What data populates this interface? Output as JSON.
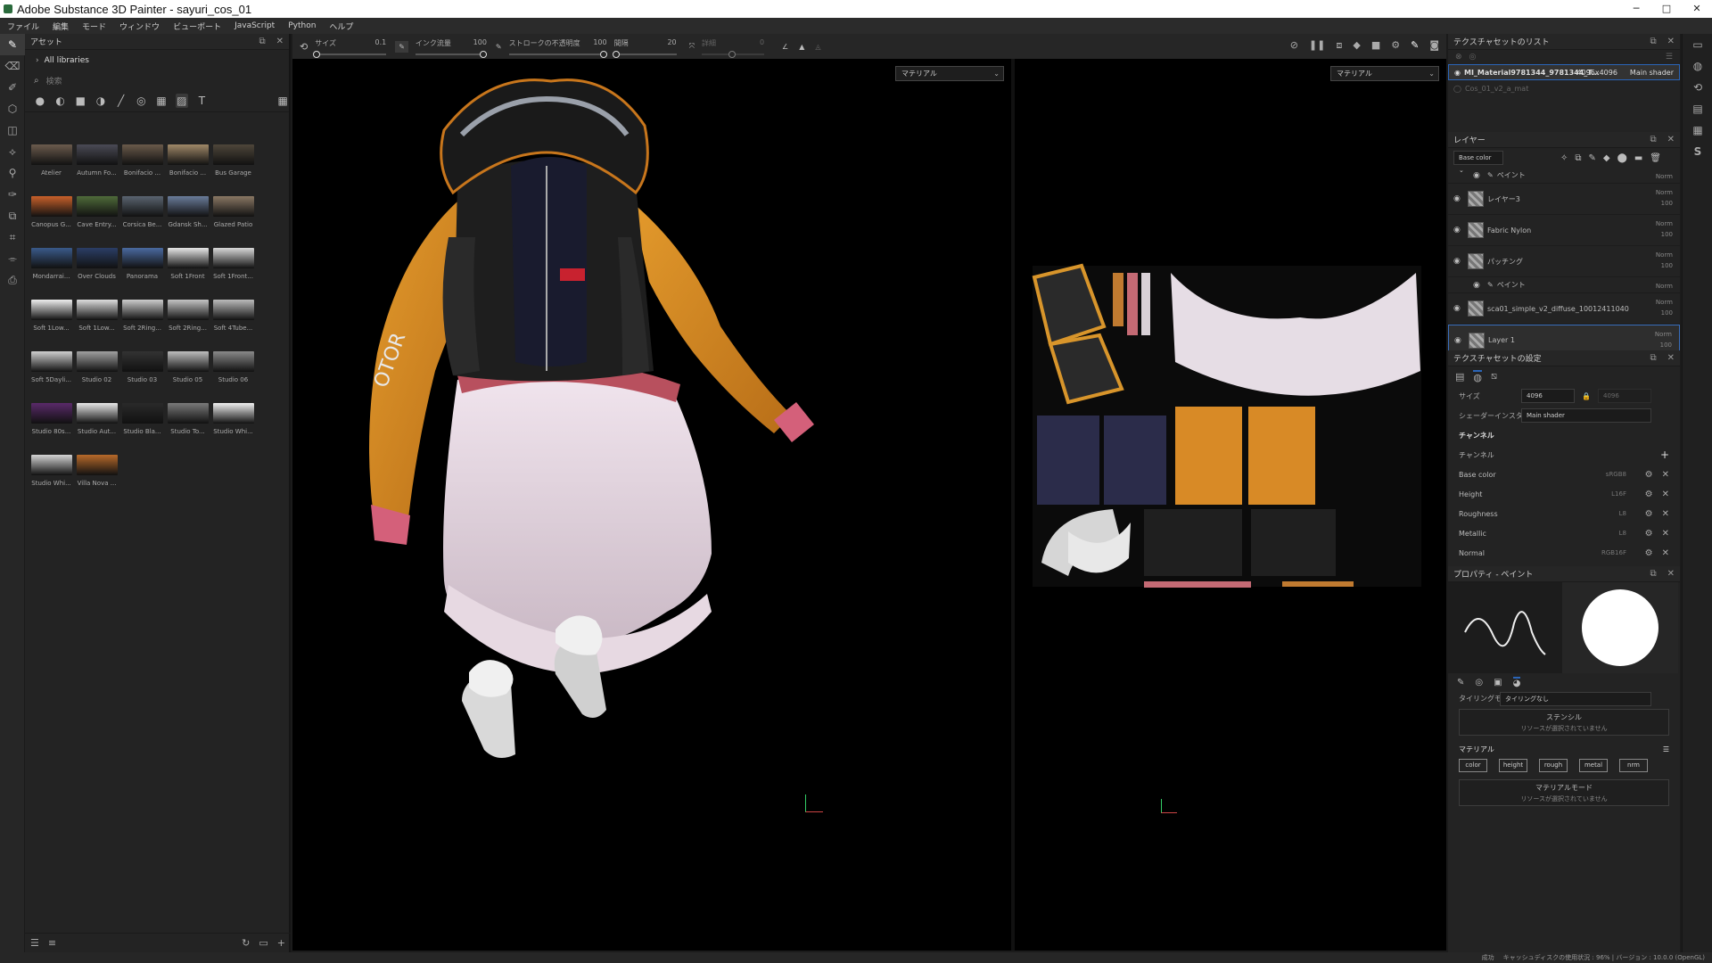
{
  "window": {
    "title": "Adobe Substance 3D Painter - sayuri_cos_01",
    "minimize": "─",
    "maximize": "□",
    "close": "✕"
  },
  "menu": [
    "ファイル",
    "編集",
    "モード",
    "ウィンドウ",
    "ビューポート",
    "JavaScript",
    "Python",
    "ヘルプ"
  ],
  "left_tools": [
    "brush-icon",
    "eraser-icon",
    "projection-icon",
    "geometry-mask-icon",
    "fill-icon",
    "smudge-icon",
    "clone-icon",
    "material-picker-icon",
    "bake-icon",
    "polygon-fill-icon",
    "picker-icon",
    "export-icon"
  ],
  "assets": {
    "title": "アセット",
    "library": "All libraries",
    "search_placeholder": "検索",
    "filter_icons": [
      "sphere-icon",
      "half-sphere-icon",
      "cube-icon",
      "pattern-icon",
      "brush-stroke-icon",
      "particle-icon",
      "grid-texture-icon",
      "environment-icon",
      "text-icon"
    ],
    "items": [
      {
        "label": "Atelier",
        "color": "#6b5b4d"
      },
      {
        "label": "Autumn Fo...",
        "color": "#4a4a55"
      },
      {
        "label": "Bonifacio ...",
        "color": "#6a5a4a"
      },
      {
        "label": "Bonifacio ...",
        "color": "#a08968"
      },
      {
        "label": "Bus Garage",
        "color": "#4e463a"
      },
      {
        "label": "Canopus G...",
        "color": "#c8602a"
      },
      {
        "label": "Cave Entry...",
        "color": "#4f6b3a"
      },
      {
        "label": "Corsica Be...",
        "color": "#5a6470"
      },
      {
        "label": "Gdansk Sh...",
        "color": "#6a7c9a"
      },
      {
        "label": "Glazed Patio",
        "color": "#8a7864"
      },
      {
        "label": "Mondarrai...",
        "color": "#3a5a8a"
      },
      {
        "label": "Over Clouds",
        "color": "#2b3e66"
      },
      {
        "label": "Panorama",
        "color": "#4a6aa0"
      },
      {
        "label": "Soft 1Front",
        "color": "#e6e6e6"
      },
      {
        "label": "Soft 1Front...",
        "color": "#d8d8d8"
      },
      {
        "label": "Soft 1Low...",
        "color": "#eeeeee"
      },
      {
        "label": "Soft 1Low...",
        "color": "#dddddd"
      },
      {
        "label": "Soft 2Ring...",
        "color": "#cccccc"
      },
      {
        "label": "Soft 2Ring...",
        "color": "#c4c4c4"
      },
      {
        "label": "Soft 4Tube...",
        "color": "#bbbbbb"
      },
      {
        "label": "Soft 5Dayli...",
        "color": "#cfcfcf"
      },
      {
        "label": "Studio 02",
        "color": "#a0a0a0"
      },
      {
        "label": "Studio 03",
        "color": "#333333"
      },
      {
        "label": "Studio 05",
        "color": "#bdbdbd"
      },
      {
        "label": "Studio 06",
        "color": "#8a8a8a"
      },
      {
        "label": "Studio 80s...",
        "color": "#5a2a6a"
      },
      {
        "label": "Studio Aut...",
        "color": "#e8e8e8"
      },
      {
        "label": "Studio Bla...",
        "color": "#2a2a2a"
      },
      {
        "label": "Studio To...",
        "color": "#7a7a7a"
      },
      {
        "label": "Studio Whi...",
        "color": "#f0f0f0"
      },
      {
        "label": "Studio Whi...",
        "color": "#d4d4d4"
      },
      {
        "label": "Villa Nova ...",
        "color": "#b86a2a"
      }
    ]
  },
  "ctxbar": {
    "size_label": "サイズ",
    "size_value": "0.1",
    "flow_label": "インク流量",
    "flow_value": "100",
    "opacity_label": "ストロークの不透明度",
    "opacity_value": "100",
    "spacing_label": "間隔",
    "spacing_value": "20",
    "jitter_label": "詳細",
    "jitter_value": "0"
  },
  "viewport": {
    "dropdown_3d": "マテリアル",
    "dropdown_2d": "マテリアル"
  },
  "textureset_list": {
    "title": "テクスチャセットのリスト",
    "items": [
      {
        "name": "MI_Material9781344_9781344_T...",
        "res": "4096x4096",
        "shader": "Main shader"
      },
      {
        "name": "Cos_01_v2_a_mat",
        "res": "",
        "shader": ""
      }
    ]
  },
  "layers": {
    "title": "レイヤー",
    "channel_select": "Base color",
    "rows": [
      {
        "name": "ペイント",
        "blend": "Norm",
        "opacity": "100",
        "sub": true
      },
      {
        "name": "レイヤー3",
        "blend": "Norm",
        "opacity": "100",
        "sub": false
      },
      {
        "name": "Fabric Nylon",
        "blend": "Norm",
        "opacity": "100",
        "sub": false
      },
      {
        "name": "パッチング",
        "blend": "Norm",
        "opacity": "100",
        "sub": false
      },
      {
        "name": "ペイント",
        "blend": "Norm",
        "opacity": "100",
        "sub": true
      },
      {
        "name": "sca01_simple_v2_diffuse_10012411040",
        "blend": "Norm",
        "opacity": "100",
        "sub": false
      },
      {
        "name": "Layer 1",
        "blend": "Norm",
        "opacity": "100",
        "sub": false,
        "selected": true
      }
    ]
  },
  "ts_settings": {
    "title": "テクスチャセットの設定",
    "size_label": "サイズ",
    "size_value": "4096",
    "size_value2": "4096",
    "shader_label": "シェーダーインスタンス",
    "shader_value": "Main shader",
    "channels_title": "チャンネル",
    "channels_label": "チャンネル",
    "channels": [
      {
        "name": "Base color",
        "fmt": "sRGB8"
      },
      {
        "name": "Height",
        "fmt": "L16F"
      },
      {
        "name": "Roughness",
        "fmt": "L8"
      },
      {
        "name": "Metallic",
        "fmt": "L8"
      },
      {
        "name": "Normal",
        "fmt": "RGB16F"
      }
    ]
  },
  "properties": {
    "title": "プロパティ - ペイント",
    "tiling_label": "タイリングモード",
    "tiling_value": "タイリングなし",
    "stencil_title": "ステンシル",
    "stencil_sub": "リソースが選択されていません",
    "material_title": "マテリアル",
    "chips": [
      "color",
      "height",
      "rough",
      "metal",
      "nrm"
    ],
    "mat_mode_title": "マテリアルモード",
    "mat_mode_sub": "リソースが選択されていません"
  },
  "status": {
    "cache": "キャッシュディスクの使用状況 : 96% | バージョン : 10.0.0 (OpenGL)",
    "cache_label": "成功"
  },
  "colors": {
    "accent": "#2b65b8",
    "orange": "#d88a26",
    "bg": "#232323"
  }
}
